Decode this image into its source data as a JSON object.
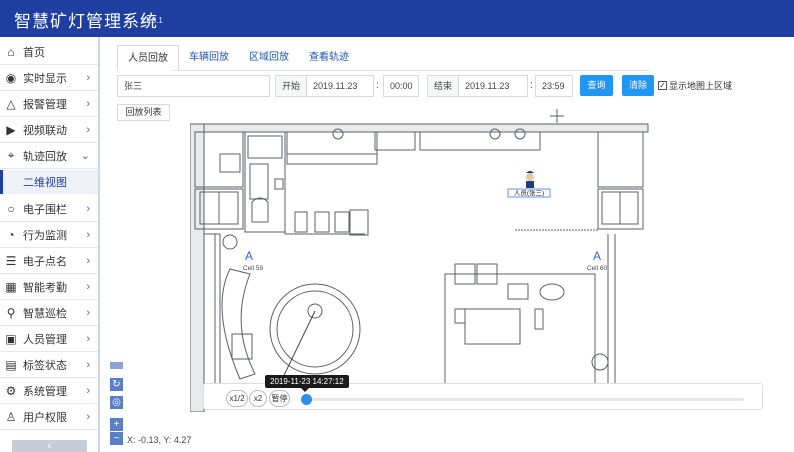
{
  "header": {
    "title": "智慧矿灯管理系统",
    "version": "v1.0.1"
  },
  "sidebar": {
    "items": [
      {
        "label": "首页",
        "icon": "home-icon",
        "chevron": false
      },
      {
        "label": "实时显示",
        "icon": "eye-icon",
        "chevron": true
      },
      {
        "label": "报警管理",
        "icon": "bell-icon",
        "chevron": true
      },
      {
        "label": "视频联动",
        "icon": "video-icon",
        "chevron": true
      },
      {
        "label": "轨迹回放",
        "icon": "route-icon",
        "chevron": true,
        "expanded": true
      },
      {
        "label": "电子围栏",
        "icon": "circle-icon",
        "chevron": true
      },
      {
        "label": "行为监测",
        "icon": "monitor-icon",
        "chevron": true
      },
      {
        "label": "电子点名",
        "icon": "list-icon",
        "chevron": true
      },
      {
        "label": "智能考勤",
        "icon": "calendar-icon",
        "chevron": true
      },
      {
        "label": "智慧巡检",
        "icon": "inspect-icon",
        "chevron": true
      },
      {
        "label": "人员管理",
        "icon": "person-card-icon",
        "chevron": true
      },
      {
        "label": "标签状态",
        "icon": "tag-icon",
        "chevron": true
      },
      {
        "label": "系统管理",
        "icon": "gear-icon",
        "chevron": true
      },
      {
        "label": "用户权限",
        "icon": "user-icon",
        "chevron": true
      }
    ],
    "sub_item": "二维视图",
    "collapse_label": "‹"
  },
  "tabs": [
    {
      "label": "人员回放",
      "active": true
    },
    {
      "label": "车辆回放",
      "active": false
    },
    {
      "label": "区域回放",
      "active": false
    },
    {
      "label": "查看轨迹",
      "active": false
    }
  ],
  "filter": {
    "person": "张三",
    "start_label": "开始",
    "start_date": "2019.11.23",
    "start_time": "00:00",
    "end_label": "结束",
    "end_date": "2019.11.23",
    "end_time": "23:59",
    "query_label": "查询",
    "clear_label": "清除",
    "show_area_label": "显示地图上区域",
    "show_area_checked": true,
    "back_list_label": "回放列表"
  },
  "map": {
    "person_label": "人员(张三)",
    "anchor_left_label": "Cell 59",
    "anchor_right_label": "Cell 60",
    "anchor_glyph": "A"
  },
  "playback": {
    "speed_half": "x1/2",
    "speed_double": "x2",
    "pause_label": "暂停",
    "timestamp": "2019-11-23 14:27:12",
    "progress": 0
  },
  "status": {
    "coords": "X: -0.13,  Y: 4.27"
  },
  "colors": {
    "header": "#1f3fa0",
    "accent": "#2196f3"
  }
}
